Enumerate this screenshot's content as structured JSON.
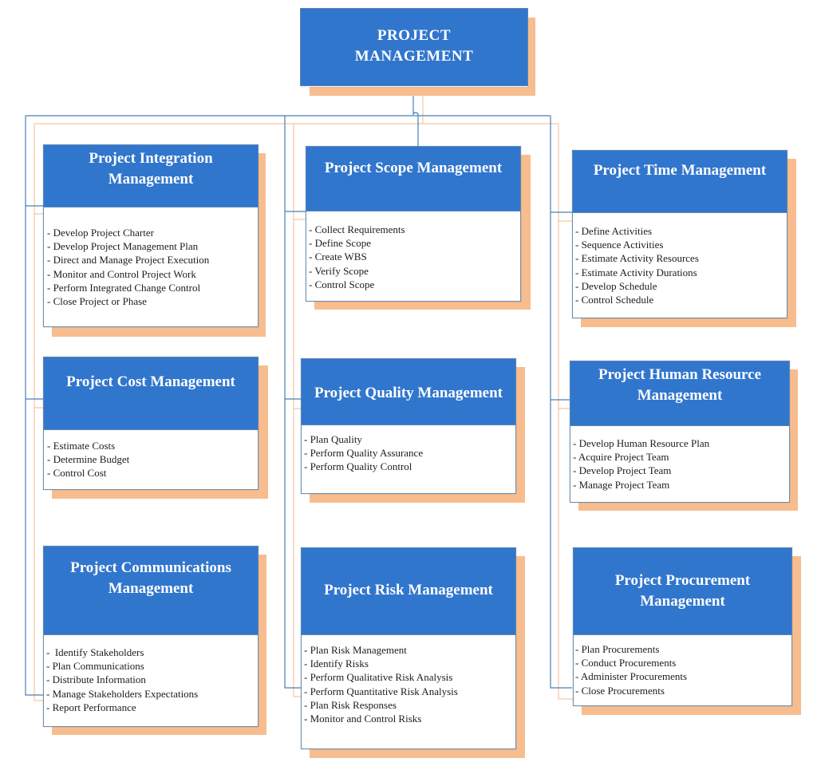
{
  "diagram": {
    "root": {
      "title": "PROJECT MANAGEMENT"
    },
    "colors": {
      "header_fill": "#3176cd",
      "shadow": "#f7bd8f",
      "connector_blue": "#4a7fb5",
      "connector_orange": "#f3c6a4",
      "text_header": "#ffffff",
      "text_body": "#1c1c1c"
    },
    "areas": [
      {
        "id": "integration",
        "title": "Project Integration Management",
        "items": [
          "- Develop Project Charter",
          "- Develop Project Management Plan",
          "- Direct and Manage Project Execution",
          "- Monitor and Control Project Work",
          "- Perform Integrated Change Control",
          "- Close Project or Phase"
        ]
      },
      {
        "id": "scope",
        "title": "Project Scope Management",
        "items": [
          "- Collect Requirements",
          "- Define Scope",
          "- Create WBS",
          "- Verify Scope",
          "- Control Scope"
        ]
      },
      {
        "id": "time",
        "title": "Project Time Management",
        "items": [
          "- Define Activities",
          "- Sequence Activities",
          "- Estimate Activity Resources",
          "- Estimate Activity Durations",
          "- Develop Schedule",
          "- Control Schedule"
        ]
      },
      {
        "id": "cost",
        "title": "Project Cost Management",
        "items": [
          "- Estimate Costs",
          "- Determine Budget",
          "- Control Cost"
        ]
      },
      {
        "id": "quality",
        "title": "Project Quality Management",
        "items": [
          "- Plan Quality",
          "- Perform Quality Assurance",
          "- Perform Quality Control"
        ]
      },
      {
        "id": "human-resource",
        "title": "Project Human Resource Management",
        "items": [
          "- Develop Human Resource Plan",
          "- Acquire Project Team",
          "- Develop Project Team",
          "- Manage Project Team"
        ]
      },
      {
        "id": "communications",
        "title": "Project Communications Management",
        "items": [
          "-  Identify Stakeholders",
          "- Plan Communications",
          "- Distribute Information",
          "- Manage Stakeholders Expectations",
          "- Report Performance"
        ]
      },
      {
        "id": "risk",
        "title": "Project Risk Management",
        "items": [
          "- Plan Risk Management",
          "- Identify Risks",
          "- Perform Qualitative Risk Analysis",
          "- Perform Quantitative Risk Analysis",
          "- Plan Risk Responses",
          "- Monitor and Control Risks"
        ]
      },
      {
        "id": "procurement",
        "title": "Project Procurement Management",
        "items": [
          "- Plan Procurements",
          "- Conduct Procurements",
          "- Administer Procurements",
          "- Close Procurements"
        ]
      }
    ]
  }
}
